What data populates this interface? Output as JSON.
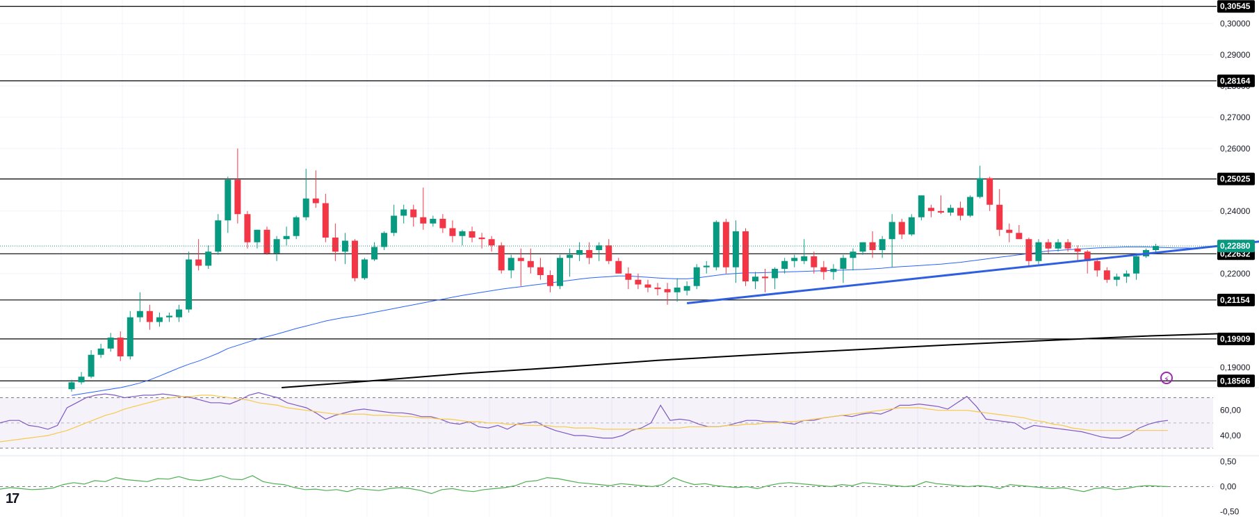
{
  "chart_data": {
    "type": "candlestick",
    "title": "",
    "price_axis": {
      "ylim": [
        0.1835,
        0.3075
      ],
      "ticks": [
        "0,30000",
        "0,29000",
        "0,28000",
        "0,27000",
        "0,26000",
        "0,24000",
        "0,22000",
        "0,19000"
      ],
      "tick_values": [
        0.3,
        0.29,
        0.28,
        0.27,
        0.26,
        0.24,
        0.22,
        0.19
      ]
    },
    "levels": [
      {
        "label": "0,30545",
        "value": 0.30545
      },
      {
        "label": "0,28164",
        "value": 0.28164
      },
      {
        "label": "0,25025",
        "value": 0.25025
      },
      {
        "label": "0,22632",
        "value": 0.22632
      },
      {
        "label": "0,21154",
        "value": 0.21154
      },
      {
        "label": "0,19909",
        "value": 0.19909
      },
      {
        "label": "0,18566",
        "value": 0.18566
      }
    ],
    "current_price": {
      "label": "0,22880",
      "value": 0.2288
    },
    "candles": [
      [
        0.183,
        0.186,
        0.1822,
        0.1852
      ],
      [
        0.1852,
        0.1885,
        0.1845,
        0.187
      ],
      [
        0.187,
        0.1955,
        0.1865,
        0.194
      ],
      [
        0.194,
        0.1975,
        0.193,
        0.196
      ],
      [
        0.196,
        0.201,
        0.195,
        0.1995
      ],
      [
        0.1995,
        0.2015,
        0.192,
        0.1935
      ],
      [
        0.1935,
        0.208,
        0.1925,
        0.206
      ],
      [
        0.206,
        0.214,
        0.2045,
        0.208
      ],
      [
        0.208,
        0.21,
        0.202,
        0.2045
      ],
      [
        0.2045,
        0.2075,
        0.203,
        0.206
      ],
      [
        0.206,
        0.2075,
        0.2045,
        0.2065
      ],
      [
        0.206,
        0.21,
        0.2045,
        0.2085
      ],
      [
        0.2085,
        0.227,
        0.2075,
        0.2245
      ],
      [
        0.2245,
        0.231,
        0.221,
        0.2225
      ],
      [
        0.2225,
        0.229,
        0.2215,
        0.227
      ],
      [
        0.227,
        0.239,
        0.226,
        0.237
      ],
      [
        0.237,
        0.251,
        0.233,
        0.25
      ],
      [
        0.25,
        0.26,
        0.236,
        0.239
      ],
      [
        0.239,
        0.24,
        0.228,
        0.23
      ],
      [
        0.23,
        0.234,
        0.228,
        0.234
      ],
      [
        0.234,
        0.235,
        0.226,
        0.2265
      ],
      [
        0.2265,
        0.232,
        0.224,
        0.231
      ],
      [
        0.231,
        0.235,
        0.229,
        0.232
      ],
      [
        0.232,
        0.2385,
        0.231,
        0.238
      ],
      [
        0.238,
        0.2535,
        0.237,
        0.244
      ],
      [
        0.244,
        0.253,
        0.241,
        0.2425
      ],
      [
        0.2425,
        0.2455,
        0.23,
        0.2315
      ],
      [
        0.2315,
        0.236,
        0.224,
        0.227
      ],
      [
        0.227,
        0.233,
        0.223,
        0.2305
      ],
      [
        0.2305,
        0.231,
        0.2175,
        0.2185
      ],
      [
        0.2185,
        0.225,
        0.218,
        0.2245
      ],
      [
        0.2245,
        0.23,
        0.224,
        0.2285
      ],
      [
        0.2285,
        0.2335,
        0.2275,
        0.233
      ],
      [
        0.233,
        0.242,
        0.232,
        0.2385
      ],
      [
        0.2385,
        0.242,
        0.236,
        0.2405
      ],
      [
        0.2405,
        0.242,
        0.235,
        0.238
      ],
      [
        0.238,
        0.2475,
        0.234,
        0.236
      ],
      [
        0.236,
        0.2385,
        0.235,
        0.2375
      ],
      [
        0.2375,
        0.239,
        0.233,
        0.2345
      ],
      [
        0.2345,
        0.237,
        0.23,
        0.232
      ],
      [
        0.232,
        0.234,
        0.229,
        0.2335
      ],
      [
        0.2335,
        0.235,
        0.23,
        0.2315
      ],
      [
        0.2315,
        0.233,
        0.228,
        0.231
      ],
      [
        0.231,
        0.232,
        0.227,
        0.229
      ],
      [
        0.229,
        0.23,
        0.22,
        0.221
      ],
      [
        0.221,
        0.226,
        0.2185,
        0.225
      ],
      [
        0.225,
        0.228,
        0.216,
        0.224
      ],
      [
        0.224,
        0.228,
        0.22,
        0.222
      ],
      [
        0.222,
        0.225,
        0.218,
        0.2195
      ],
      [
        0.2195,
        0.221,
        0.214,
        0.216
      ],
      [
        0.216,
        0.226,
        0.215,
        0.225
      ],
      [
        0.225,
        0.228,
        0.219,
        0.226
      ],
      [
        0.226,
        0.23,
        0.224,
        0.2275
      ],
      [
        0.2275,
        0.23,
        0.223,
        0.225
      ],
      [
        0.2275,
        0.23,
        0.224,
        0.229
      ],
      [
        0.229,
        0.231,
        0.223,
        0.224
      ],
      [
        0.224,
        0.225,
        0.22,
        0.22
      ],
      [
        0.22,
        0.222,
        0.215,
        0.218
      ],
      [
        0.218,
        0.22,
        0.215,
        0.2165
      ],
      [
        0.2165,
        0.218,
        0.214,
        0.2155
      ],
      [
        0.2155,
        0.217,
        0.213,
        0.215
      ],
      [
        0.215,
        0.217,
        0.21,
        0.214
      ],
      [
        0.214,
        0.2185,
        0.211,
        0.2155
      ],
      [
        0.2145,
        0.2175,
        0.213,
        0.216
      ],
      [
        0.216,
        0.223,
        0.215,
        0.222
      ],
      [
        0.222,
        0.224,
        0.22,
        0.2225
      ],
      [
        0.222,
        0.237,
        0.221,
        0.2365
      ],
      [
        0.2365,
        0.2375,
        0.22,
        0.222
      ],
      [
        0.222,
        0.237,
        0.217,
        0.2335
      ],
      [
        0.2335,
        0.2345,
        0.216,
        0.2175
      ],
      [
        0.2175,
        0.2205,
        0.215,
        0.219
      ],
      [
        0.219,
        0.2215,
        0.214,
        0.2185
      ],
      [
        0.2185,
        0.222,
        0.215,
        0.2215
      ],
      [
        0.2215,
        0.225,
        0.22,
        0.224
      ],
      [
        0.224,
        0.226,
        0.222,
        0.225
      ],
      [
        0.224,
        0.231,
        0.223,
        0.2255
      ],
      [
        0.2255,
        0.227,
        0.22,
        0.222
      ],
      [
        0.222,
        0.224,
        0.218,
        0.2205
      ],
      [
        0.2205,
        0.223,
        0.218,
        0.2215
      ],
      [
        0.2215,
        0.226,
        0.217,
        0.225
      ],
      [
        0.225,
        0.228,
        0.221,
        0.227
      ],
      [
        0.227,
        0.23,
        0.226,
        0.23
      ],
      [
        0.23,
        0.2335,
        0.225,
        0.2275
      ],
      [
        0.2275,
        0.232,
        0.225,
        0.231
      ],
      [
        0.231,
        0.239,
        0.222,
        0.2365
      ],
      [
        0.2365,
        0.2375,
        0.231,
        0.2325
      ],
      [
        0.2325,
        0.239,
        0.232,
        0.238
      ],
      [
        0.238,
        0.2445,
        0.237,
        0.245
      ],
      [
        0.241,
        0.242,
        0.238,
        0.24
      ],
      [
        0.24,
        0.245,
        0.239,
        0.2395
      ],
      [
        0.2395,
        0.242,
        0.2385,
        0.241
      ],
      [
        0.241,
        0.243,
        0.237,
        0.2385
      ],
      [
        0.2385,
        0.245,
        0.238,
        0.2445
      ],
      [
        0.2445,
        0.2545,
        0.244,
        0.2505
      ],
      [
        0.2505,
        0.251,
        0.24,
        0.242
      ],
      [
        0.242,
        0.247,
        0.232,
        0.234
      ],
      [
        0.234,
        0.236,
        0.23,
        0.233
      ],
      [
        0.233,
        0.2355,
        0.231,
        0.231
      ],
      [
        0.231,
        0.2315,
        0.222,
        0.224
      ],
      [
        0.224,
        0.231,
        0.223,
        0.23
      ],
      [
        0.23,
        0.231,
        0.2265,
        0.228
      ],
      [
        0.228,
        0.231,
        0.227,
        0.23
      ],
      [
        0.23,
        0.231,
        0.227,
        0.228
      ],
      [
        0.228,
        0.229,
        0.224,
        0.227
      ],
      [
        0.227,
        0.2275,
        0.22,
        0.224
      ],
      [
        0.224,
        0.225,
        0.219,
        0.221
      ],
      [
        0.221,
        0.222,
        0.217,
        0.218
      ],
      [
        0.218,
        0.22,
        0.216,
        0.219
      ],
      [
        0.219,
        0.221,
        0.217,
        0.22
      ],
      [
        0.22,
        0.2265,
        0.218,
        0.2255
      ],
      [
        0.2255,
        0.228,
        0.225,
        0.2275
      ],
      [
        0.2275,
        0.2295,
        0.2265,
        0.2288
      ]
    ],
    "rsi": {
      "ylim": [
        24,
        78
      ],
      "band": [
        70,
        30
      ],
      "mid": 50,
      "ticks": [
        "60,00",
        "40,00"
      ],
      "tick_values": [
        60,
        40
      ],
      "values": [
        50,
        52,
        52,
        48,
        47,
        45,
        48,
        62,
        66,
        70,
        72,
        73,
        72,
        70,
        71,
        72,
        72,
        73,
        72,
        71,
        70,
        68,
        66,
        66,
        65,
        68,
        72,
        74,
        72,
        70,
        66,
        64,
        62,
        58,
        53,
        56,
        58,
        60,
        61,
        60,
        59,
        58,
        58,
        57,
        55,
        55,
        53,
        50,
        49,
        51,
        47,
        46,
        48,
        45,
        49,
        50,
        51,
        47,
        44,
        42,
        40,
        40,
        39,
        38,
        38,
        40,
        44,
        46,
        50,
        64,
        52,
        53,
        52,
        49,
        47,
        47,
        48,
        50,
        52,
        52,
        51,
        51,
        50,
        49,
        52,
        52,
        54,
        55,
        56,
        55,
        57,
        58,
        57,
        60,
        64,
        64,
        65,
        64,
        63,
        61,
        66,
        71,
        63,
        53,
        52,
        51,
        50,
        45,
        48,
        47,
        46,
        45,
        44,
        43,
        41,
        39,
        38,
        38,
        41,
        46,
        49,
        51,
        52
      ],
      "ma_values": [
        35,
        36,
        37,
        38,
        39,
        40,
        42,
        44,
        47,
        50,
        53,
        56,
        58,
        61,
        63,
        65,
        67,
        69,
        70,
        71,
        71,
        72,
        72,
        71,
        70,
        69,
        68,
        66,
        65,
        64,
        62,
        61,
        60,
        59,
        58,
        57,
        57,
        57,
        57,
        56,
        56,
        56,
        55,
        55,
        54,
        54,
        53,
        53,
        52,
        51,
        51,
        50,
        50,
        49,
        49,
        48,
        48,
        48,
        47,
        47,
        46,
        46,
        46,
        45,
        45,
        45,
        45,
        45,
        46,
        46,
        46,
        46,
        47,
        47,
        47,
        47,
        48,
        48,
        49,
        49,
        50,
        50,
        51,
        51,
        52,
        53,
        54,
        55,
        56,
        57,
        58,
        59,
        60,
        61,
        62,
        62,
        62,
        61,
        60,
        60,
        60,
        60,
        59,
        58,
        57,
        56,
        55,
        54,
        52,
        51,
        49,
        48,
        46,
        45,
        44,
        44,
        44,
        44,
        44,
        44,
        44,
        44,
        44
      ]
    },
    "oscillator": {
      "ylim": [
        -0.62,
        0.62
      ],
      "ticks": [
        "0,50",
        "0,00",
        "-0,50"
      ],
      "tick_values": [
        0.5,
        0.0,
        -0.5
      ],
      "values": [
        -0.05,
        -0.02,
        -0.04,
        -0.06,
        -0.05,
        -0.03,
        0.04,
        0.08,
        0.05,
        0.12,
        0.1,
        0.18,
        0.14,
        0.12,
        0.1,
        0.16,
        0.15,
        0.2,
        0.14,
        0.12,
        0.16,
        0.22,
        0.15,
        0.14,
        0.22,
        0.1,
        0.06,
        0.04,
        -0.02,
        -0.06,
        -0.05,
        -0.08,
        -0.06,
        -0.1,
        -0.04,
        -0.06,
        -0.08,
        -0.04,
        -0.02,
        -0.04,
        -0.08,
        -0.14,
        -0.06,
        -0.04,
        -0.08,
        -0.1,
        -0.06,
        -0.04,
        -0.02,
        0.02,
        0.1,
        0.12,
        0.18,
        0.16,
        0.12,
        0.08,
        0.06,
        0.04,
        0.02,
        0.06,
        0.04,
        0.02,
        0.0,
        0.04,
        0.18,
        0.1,
        0.04,
        0.06,
        0.02,
        0.0,
        -0.02,
        0.0,
        -0.04,
        0.02,
        0.06,
        0.08,
        0.06,
        0.04,
        0.02,
        0.0,
        0.04,
        0.02,
        0.08,
        0.06,
        0.04,
        0.02,
        0.0,
        0.02,
        0.1,
        0.06,
        0.04,
        0.02,
        0.0,
        0.02,
        0.0,
        -0.04,
        0.04,
        0.02,
        0.0,
        -0.02,
        -0.04,
        -0.02,
        -0.06,
        -0.1,
        -0.04,
        -0.02,
        -0.06,
        -0.04,
        0.0,
        0.02,
        0.01,
        0.0
      ]
    },
    "ma50": [
      0.181,
      0.1815,
      0.182,
      0.1825,
      0.183,
      0.1835,
      0.1842,
      0.185,
      0.186,
      0.1872,
      0.1885,
      0.1898,
      0.191,
      0.192,
      0.1932,
      0.1945,
      0.196,
      0.197,
      0.198,
      0.199,
      0.1998,
      0.2006,
      0.2015,
      0.2024,
      0.2032,
      0.204,
      0.2048,
      0.2054,
      0.206,
      0.2064,
      0.207,
      0.2076,
      0.2082,
      0.2088,
      0.2094,
      0.21,
      0.2106,
      0.2112,
      0.2118,
      0.2124,
      0.213,
      0.2135,
      0.214,
      0.2145,
      0.215,
      0.2154,
      0.2158,
      0.2162,
      0.2166,
      0.217,
      0.2174,
      0.2178,
      0.2182,
      0.2186,
      0.2188,
      0.219,
      0.2192,
      0.2192,
      0.219,
      0.2188,
      0.2186,
      0.2184,
      0.2183,
      0.2183,
      0.2186,
      0.219,
      0.2194,
      0.2198,
      0.22,
      0.2202,
      0.2202,
      0.2203,
      0.2204,
      0.2205,
      0.2206,
      0.2207,
      0.2208,
      0.2209,
      0.221,
      0.2211,
      0.2212,
      0.2213,
      0.2215,
      0.2217,
      0.222,
      0.2222,
      0.2224,
      0.2226,
      0.2228,
      0.223,
      0.2233,
      0.2236,
      0.224,
      0.2244,
      0.2248,
      0.2252,
      0.2256,
      0.226,
      0.2264,
      0.2268,
      0.2272,
      0.2274,
      0.2276,
      0.2278,
      0.228,
      0.2282,
      0.2283,
      0.2284,
      0.2285,
      0.2285,
      0.2285,
      0.2284,
      0.2283,
      0.2282,
      0.2282,
      0.2281,
      0.2282
    ],
    "ma200": {
      "points": [
        [
          21.5,
          0.1835
        ],
        [
          30,
          0.1855
        ],
        [
          40,
          0.188
        ],
        [
          50,
          0.19
        ],
        [
          60,
          0.1922
        ],
        [
          70,
          0.194
        ],
        [
          80,
          0.1956
        ],
        [
          90,
          0.1972
        ],
        [
          100,
          0.1986
        ],
        [
          110,
          0.2
        ],
        [
          118,
          0.2008
        ]
      ]
    },
    "trendline": {
      "from": [
        63,
        0.2105
      ],
      "to": [
        122,
        0.2306
      ]
    },
    "colors": {
      "up": "#089981",
      "down": "#f23645",
      "ma50": "#2962ff",
      "ma200": "#000000",
      "trend": "#2f5fe0",
      "rsi": "#7e57c2",
      "rsi_ma": "#f7c948",
      "osc": "#4caf50",
      "level": "#000000",
      "price": "#089981"
    }
  },
  "logo_text": "17"
}
